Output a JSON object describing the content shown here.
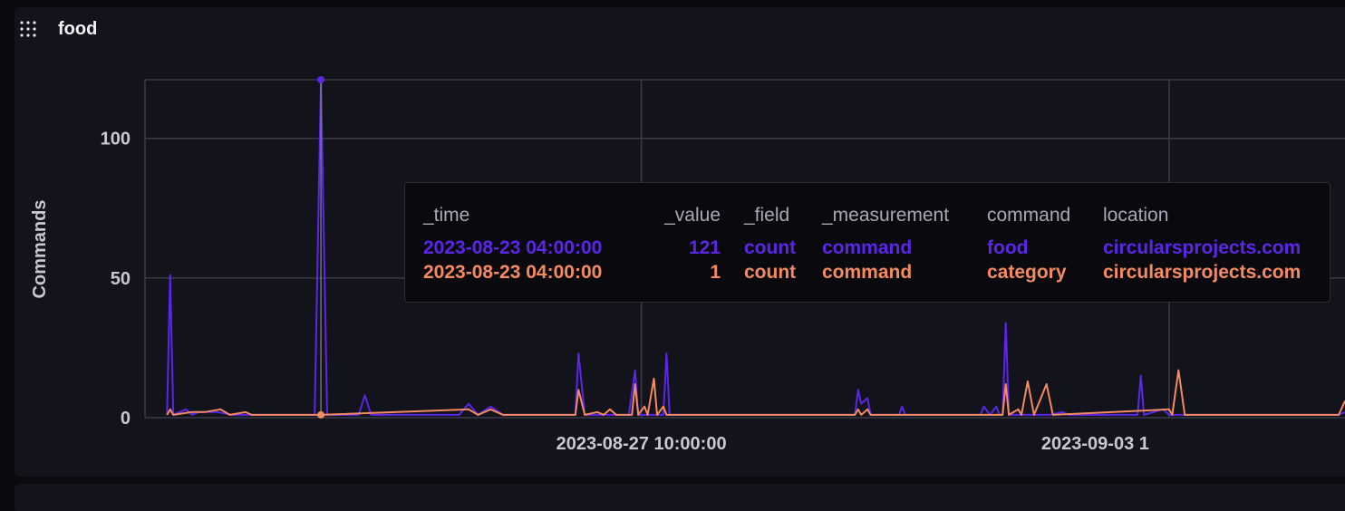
{
  "panel": {
    "title": "food",
    "grip_icon": "drag-handle-icon"
  },
  "colors": {
    "series_1": "#5b26e8",
    "series_2": "#f48a62",
    "background": "#13131c",
    "grid": "#3b3b48",
    "text": "#c8c8d2"
  },
  "chart_data": {
    "type": "line",
    "ylabel": "Commands",
    "xlabel": "",
    "ylim": [
      0,
      121
    ],
    "y_ticks": [
      0,
      50,
      100
    ],
    "x_tick_labels": [
      "2023-08-27 10:00:00",
      "2023-09-03 1"
    ],
    "x_range": [
      "2023-08-20 20:00",
      "2023-09-05 18:00"
    ],
    "grid": true,
    "hover_time": "2023-08-23 04:00:00",
    "series": [
      {
        "color": "#5b26e8",
        "points": [
          [
            "2023-08-21 03:00",
            1
          ],
          [
            "2023-08-21 04:00",
            51
          ],
          [
            "2023-08-21 05:00",
            1
          ],
          [
            "2023-08-21 09:00",
            3
          ],
          [
            "2023-08-21 11:00",
            1
          ],
          [
            "2023-08-21 13:00",
            2
          ],
          [
            "2023-08-21 19:00",
            2
          ],
          [
            "2023-08-22 00:00",
            1
          ],
          [
            "2023-08-23 02:00",
            1
          ],
          [
            "2023-08-23 04:00",
            121
          ],
          [
            "2023-08-23 06:00",
            1
          ],
          [
            "2023-08-23 16:00",
            1
          ],
          [
            "2023-08-23 18:00",
            8
          ],
          [
            "2023-08-23 20:00",
            1
          ],
          [
            "2023-08-25 00:00",
            1
          ],
          [
            "2023-08-25 03:00",
            5
          ],
          [
            "2023-08-25 06:00",
            1
          ],
          [
            "2023-08-25 10:00",
            4
          ],
          [
            "2023-08-25 14:00",
            1
          ],
          [
            "2023-08-26 13:00",
            1
          ],
          [
            "2023-08-26 14:00",
            23
          ],
          [
            "2023-08-26 16:00",
            1
          ],
          [
            "2023-08-27 06:00",
            1
          ],
          [
            "2023-08-27 08:00",
            17
          ],
          [
            "2023-08-27 09:00",
            1
          ],
          [
            "2023-08-27 17:00",
            1
          ],
          [
            "2023-08-27 18:00",
            23
          ],
          [
            "2023-08-27 19:00",
            1
          ],
          [
            "2023-08-30 06:00",
            1
          ],
          [
            "2023-08-30 07:00",
            10
          ],
          [
            "2023-08-30 08:00",
            5
          ],
          [
            "2023-08-30 10:00",
            7
          ],
          [
            "2023-08-30 11:00",
            1
          ],
          [
            "2023-08-30 20:00",
            1
          ],
          [
            "2023-08-30 21:00",
            4
          ],
          [
            "2023-08-30 22:00",
            1
          ],
          [
            "2023-08-31 22:00",
            1
          ],
          [
            "2023-08-31 23:00",
            4
          ],
          [
            "2023-09-01 01:00",
            1
          ],
          [
            "2023-09-01 03:00",
            4
          ],
          [
            "2023-09-01 04:00",
            1
          ],
          [
            "2023-09-01 05:00",
            1
          ],
          [
            "2023-09-01 06:00",
            34
          ],
          [
            "2023-09-01 07:00",
            1
          ],
          [
            "2023-09-01 20:00",
            1
          ],
          [
            "2023-09-02 00:00",
            2
          ],
          [
            "2023-09-02 02:00",
            1
          ],
          [
            "2023-09-03 00:00",
            1
          ],
          [
            "2023-09-03 01:00",
            15
          ],
          [
            "2023-09-03 02:00",
            1
          ],
          [
            "2023-09-03 08:00",
            3
          ],
          [
            "2023-09-03 10:00",
            1
          ],
          [
            "2023-09-05 16:00",
            1
          ],
          [
            "2023-09-05 18:00",
            2
          ]
        ]
      },
      {
        "color": "#f48a62",
        "points": [
          [
            "2023-08-21 03:00",
            1
          ],
          [
            "2023-08-21 04:00",
            3
          ],
          [
            "2023-08-21 05:00",
            1
          ],
          [
            "2023-08-21 11:00",
            2
          ],
          [
            "2023-08-21 15:00",
            2
          ],
          [
            "2023-08-21 20:00",
            3
          ],
          [
            "2023-08-21 23:00",
            1
          ],
          [
            "2023-08-22 04:00",
            2
          ],
          [
            "2023-08-22 06:00",
            1
          ],
          [
            "2023-08-23 04:00",
            1
          ],
          [
            "2023-08-25 03:00",
            3
          ],
          [
            "2023-08-25 06:00",
            1
          ],
          [
            "2023-08-25 10:00",
            3
          ],
          [
            "2023-08-25 14:00",
            1
          ],
          [
            "2023-08-26 13:00",
            1
          ],
          [
            "2023-08-26 14:00",
            10
          ],
          [
            "2023-08-26 16:00",
            1
          ],
          [
            "2023-08-26 20:00",
            2
          ],
          [
            "2023-08-26 22:00",
            1
          ],
          [
            "2023-08-27 00:00",
            3
          ],
          [
            "2023-08-27 02:00",
            1
          ],
          [
            "2023-08-27 07:00",
            1
          ],
          [
            "2023-08-27 08:00",
            12
          ],
          [
            "2023-08-27 09:00",
            1
          ],
          [
            "2023-08-27 11:00",
            4
          ],
          [
            "2023-08-27 12:00",
            1
          ],
          [
            "2023-08-27 14:00",
            14
          ],
          [
            "2023-08-27 15:00",
            1
          ],
          [
            "2023-08-27 17:00",
            4
          ],
          [
            "2023-08-27 18:00",
            1
          ],
          [
            "2023-08-30 06:00",
            1
          ],
          [
            "2023-08-30 07:00",
            3
          ],
          [
            "2023-08-30 08:00",
            1
          ],
          [
            "2023-08-30 10:00",
            3
          ],
          [
            "2023-08-30 11:00",
            1
          ],
          [
            "2023-09-01 05:00",
            1
          ],
          [
            "2023-09-01 06:00",
            12
          ],
          [
            "2023-09-01 07:00",
            1
          ],
          [
            "2023-09-01 10:00",
            3
          ],
          [
            "2023-09-01 11:00",
            1
          ],
          [
            "2023-09-01 13:00",
            13
          ],
          [
            "2023-09-01 15:00",
            1
          ],
          [
            "2023-09-01 19:00",
            12
          ],
          [
            "2023-09-01 21:00",
            1
          ],
          [
            "2023-09-03 10:00",
            3
          ],
          [
            "2023-09-03 11:00",
            1
          ],
          [
            "2023-09-03 13:00",
            17
          ],
          [
            "2023-09-03 15:00",
            1
          ],
          [
            "2023-09-05 16:00",
            1
          ],
          [
            "2023-09-05 18:00",
            6
          ]
        ]
      }
    ]
  },
  "tooltip": {
    "columns": [
      "_time",
      "_value",
      "_field",
      "_measurement",
      "command",
      "location"
    ],
    "rows": [
      [
        "2023-08-23 04:00:00",
        "121",
        "count",
        "command",
        "food",
        "circularsprojects.com"
      ],
      [
        "2023-08-23 04:00:00",
        "1",
        "count",
        "command",
        "category",
        "circularsprojects.com"
      ]
    ]
  }
}
